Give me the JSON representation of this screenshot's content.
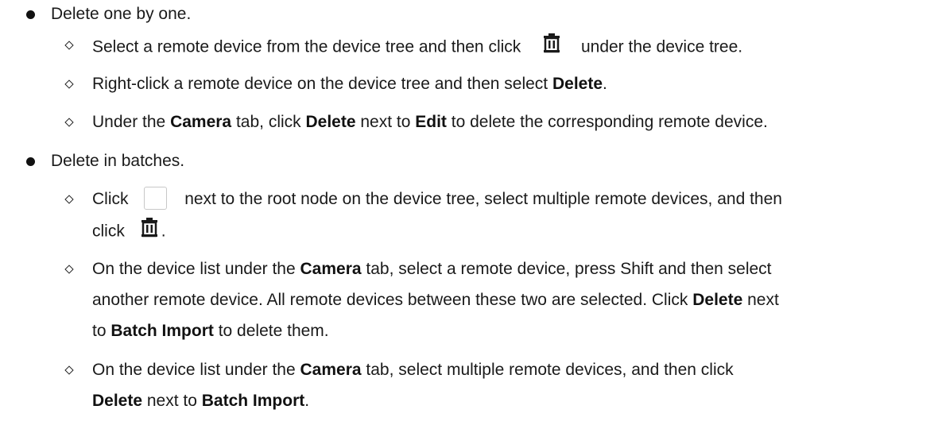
{
  "items": [
    {
      "text": "Delete one by one.",
      "subitems": [
        {
          "a": "Select a remote device from the device tree and then click",
          "icon": "trash-icon",
          "b": "under the device tree."
        },
        {
          "a": "Right-click a remote device on the device tree and then select ",
          "bold1": "Delete",
          "b": "."
        },
        {
          "a": "Under the ",
          "bold1": "Camera",
          "b": " tab, click ",
          "bold2": "Delete",
          "c": " next to ",
          "bold3": "Edit",
          "d": " to delete the corresponding remote device."
        }
      ]
    },
    {
      "text": "Delete in batches.",
      "subitems": [
        {
          "a": "Click",
          "icon": "checkbox-icon",
          "b": "next to the root node on the device tree, select multiple remote devices, and then",
          "line2a": "click",
          "line2icon": "trash-icon",
          "line2b": "."
        },
        {
          "a": "On the device list under the ",
          "bold1": "Camera",
          "b": " tab, select a remote device, press Shift and then select",
          "line2": "another remote device. All remote devices between these two are selected. Click ",
          "line2bold": "Delete",
          "line2c": " next",
          "line3a": "to ",
          "line3bold": "Batch Import",
          "line3b": " to delete them."
        },
        {
          "a": "On the device list under the ",
          "bold1": "Camera",
          "b": " tab, select multiple remote devices, and then click",
          "line2bold1": "Delete",
          "line2a": " next to ",
          "line2bold2": "Batch Import",
          "line2b": "."
        }
      ]
    }
  ]
}
